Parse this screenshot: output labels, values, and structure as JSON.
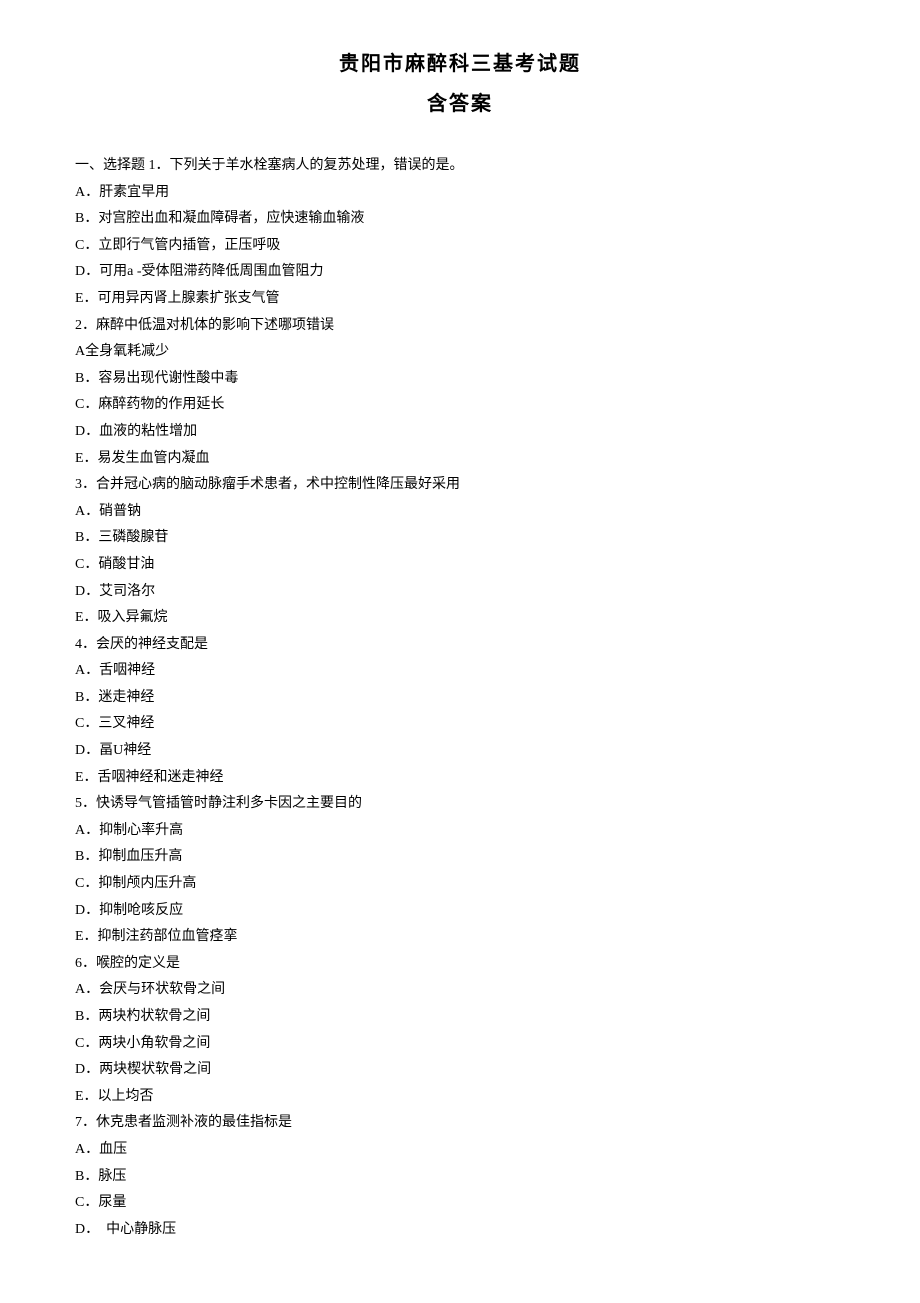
{
  "title": "贵阳市麻醉科三基考试题",
  "subtitle": "含答案",
  "section_header": "一、选择题",
  "questions": [
    {
      "num": "1．",
      "stem": "下列关于羊水栓塞病人的复苏处理，错误的是。",
      "options": [
        "A．肝素宜早用",
        "B．对宫腔出血和凝血障碍者，应快速输血输液",
        "C．立即行气管内插管，正压呼吸",
        "D．可用a -受体阻滞药降低周围血管阻力",
        "E．可用异丙肾上腺素扩张支气管"
      ]
    },
    {
      "num": "2．",
      "stem": "麻醉中低温对机体的影响下述哪项错误",
      "options": [
        "A全身氧耗减少",
        "B．容易出现代谢性酸中毒",
        "C．麻醉药物的作用延长",
        "D．血液的粘性增加",
        "E．易发生血管内凝血"
      ]
    },
    {
      "num": "3．",
      "stem": "合并冠心病的脑动脉瘤手术患者，术中控制性降压最好采用",
      "options": [
        "A．硝普钠",
        "B．三磷酸腺苷",
        "C．硝酸甘油",
        "D．艾司洛尔",
        "E．吸入异氟烷"
      ]
    },
    {
      "num": "4．",
      "stem": "会厌的神经支配是",
      "options": [
        "A．舌咽神经",
        "B．迷走神经",
        "C．三叉神经",
        "D．畐U神经",
        "E．舌咽神经和迷走神经"
      ]
    },
    {
      "num": "5．",
      "stem": "快诱导气管插管时静注利多卡因之主要目的",
      "options": [
        "A．抑制心率升高",
        "B．抑制血压升高",
        "C．抑制颅内压升高",
        "D．抑制呛咳反应",
        "E．抑制注药部位血管痉挛"
      ]
    },
    {
      "num": "6．",
      "stem": "喉腔的定义是",
      "options": [
        "A．会厌与环状软骨之间",
        "B．两块杓状软骨之间",
        "C．两块小角软骨之间",
        "D．两块楔状软骨之间",
        "E．以上均否"
      ]
    },
    {
      "num": "7．",
      "stem": "休克患者监测补液的最佳指标是",
      "options": [
        "A．血压",
        "B．脉压",
        "C．尿量",
        "D．　中心静脉压"
      ]
    }
  ]
}
